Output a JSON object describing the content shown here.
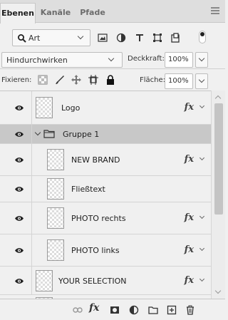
{
  "tabs": [
    {
      "label": "Ebenen",
      "active": true
    },
    {
      "label": "Kanäle",
      "active": false
    },
    {
      "label": "Pfade",
      "active": false
    }
  ],
  "filter": {
    "kind_label": "Art",
    "icons": [
      "image-filter-icon",
      "adjustment-filter-icon",
      "type-filter-icon",
      "shape-filter-icon",
      "smart-object-filter-icon",
      "filter-toggle-icon"
    ]
  },
  "blend": {
    "mode": "Hindurchwirken",
    "opacity_label": "Deckkraft:",
    "opacity_value": "100%"
  },
  "lock": {
    "label": "Fixieren:",
    "fill_label": "Fläche:",
    "fill_value": "100%"
  },
  "layers": [
    {
      "name": "Logo",
      "fx": "fx",
      "selected": false,
      "group": false
    },
    {
      "name": "Gruppe 1",
      "fx": "",
      "selected": true,
      "group": true
    },
    {
      "name": "NEW BRAND",
      "fx": "fx",
      "selected": false,
      "group": false
    },
    {
      "name": "Fließtext",
      "fx": "",
      "selected": false,
      "group": false
    },
    {
      "name": "PHOTO rechts",
      "fx": "fx",
      "selected": false,
      "group": false
    },
    {
      "name": "PHOTO links",
      "fx": "fx",
      "selected": false,
      "group": false
    },
    {
      "name": "YOUR SELECTION",
      "fx": "fx",
      "selected": false,
      "group": false
    }
  ],
  "footer": {
    "fx_label": "fx",
    "icons": [
      "link-icon",
      "fx-icon",
      "mask-icon",
      "adjustment-layer-icon",
      "new-group-icon",
      "new-layer-icon",
      "delete-icon"
    ]
  },
  "colors": {
    "panel_bg": "#f0f0f0",
    "selected_row": "#c8c8c8",
    "tab_bar": "#dedede"
  }
}
